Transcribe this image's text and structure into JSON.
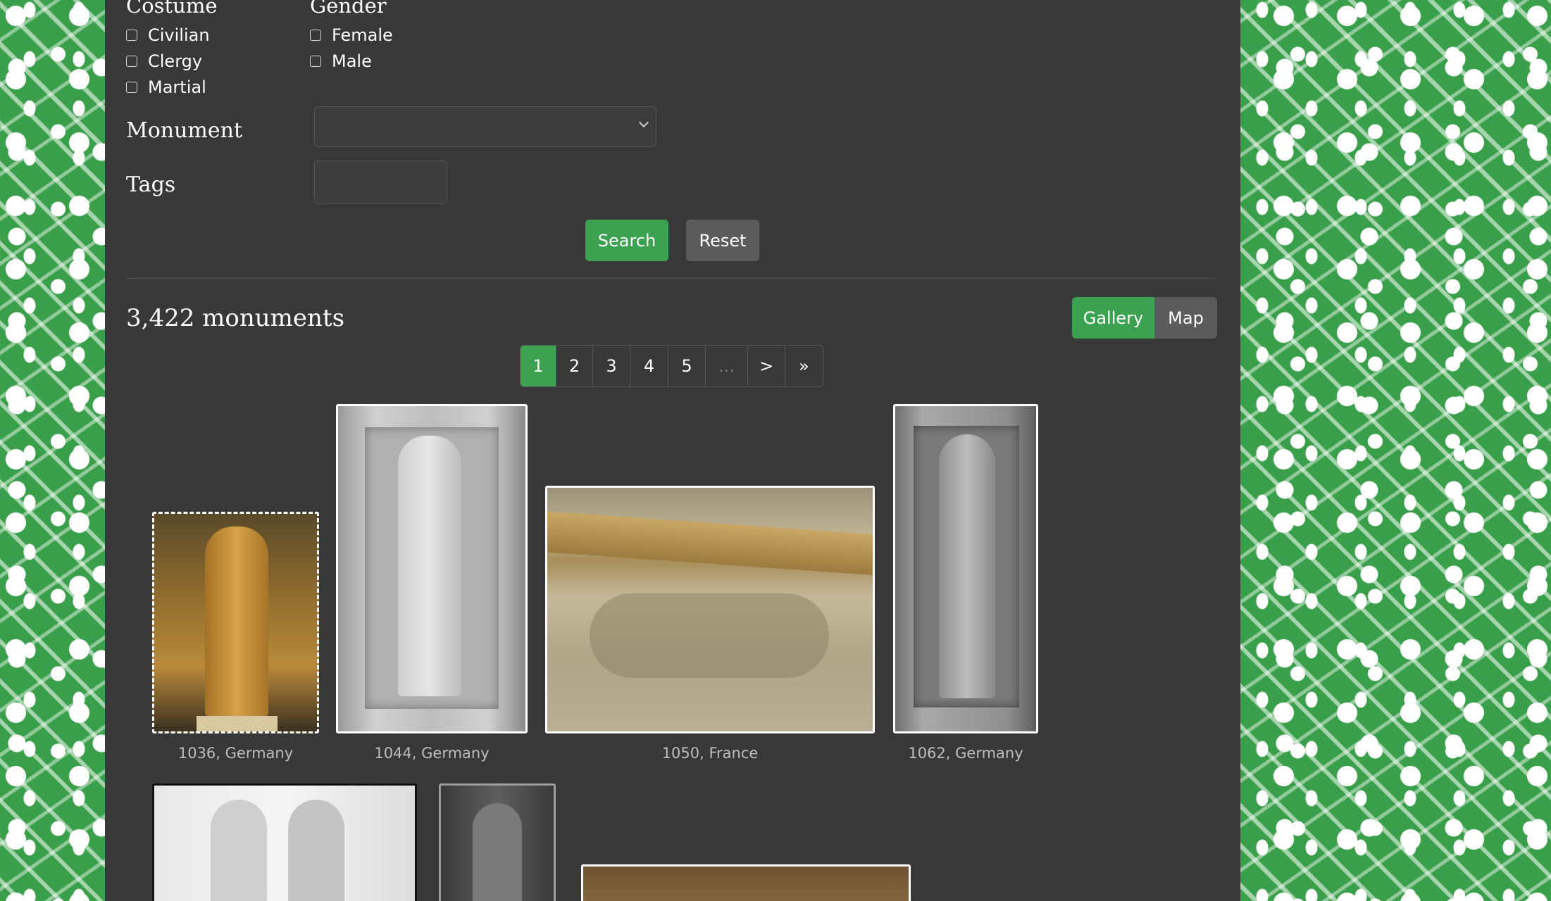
{
  "filters": {
    "costume": {
      "title": "Costume",
      "options": [
        "Civilian",
        "Clergy",
        "Martial"
      ]
    },
    "gender": {
      "title": "Gender",
      "options": [
        "Female",
        "Male"
      ]
    },
    "monument": {
      "label": "Monument",
      "value": ""
    },
    "tags": {
      "label": "Tags",
      "value": ""
    },
    "search_label": "Search",
    "reset_label": "Reset"
  },
  "results": {
    "count_text": "3,422 monuments",
    "view_toggle": {
      "gallery": "Gallery",
      "map": "Map",
      "active": "Gallery"
    }
  },
  "pagination": {
    "pages": [
      "1",
      "2",
      "3",
      "4",
      "5"
    ],
    "ellipsis": "...",
    "next": ">",
    "last": "»",
    "current": "1"
  },
  "gallery": [
    {
      "caption": "1036, Germany"
    },
    {
      "caption": "1044, Germany"
    },
    {
      "caption": "1050, France"
    },
    {
      "caption": "1062, Germany"
    }
  ],
  "colors": {
    "accent": "#3da152",
    "panel": "#383838",
    "background_pattern": "#3a9f4a"
  }
}
